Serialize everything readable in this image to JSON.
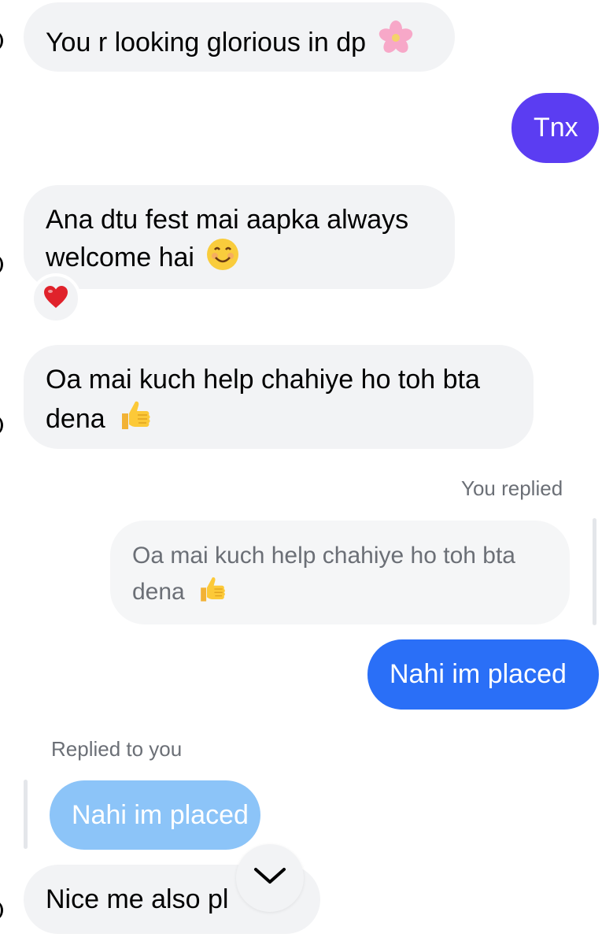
{
  "colors": {
    "incoming_bubble": "#f2f3f5",
    "outgoing_purple": "#5b3df2",
    "outgoing_blue": "#2a6ff7",
    "quoted_incoming_bubble": "#8cc4f8",
    "meta_text": "#6b6f76"
  },
  "messages": [
    {
      "text": "You r looking glorious in dp",
      "emoji": "cherry-blossom-icon"
    },
    {
      "text": "Tnx"
    },
    {
      "line1": "Ana dtu fest mai aapka always",
      "line2": "welcome hai",
      "emoji": "smiling-face-icon",
      "reaction": "heart-icon"
    },
    {
      "line1": "Oa mai kuch help chahiye ho toh bta",
      "line2": "dena",
      "emoji": "thumbs-up-icon"
    },
    {
      "reply_label": "You replied",
      "quote_line1": "Oa mai kuch help chahiye ho toh bta",
      "quote_line2": "dena",
      "quote_emoji": "thumbs-up-icon",
      "text": "Nahi im placed"
    },
    {
      "reply_label": "Replied to you",
      "quote_text": "Nahi im placed",
      "text": "Nice me also pl"
    }
  ],
  "scroll_down_icon": "chevron-down-icon"
}
